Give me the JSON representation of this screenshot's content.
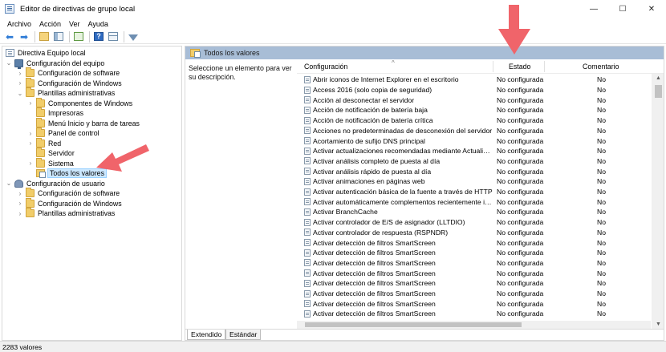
{
  "window": {
    "title": "Editor de directivas de grupo local",
    "controls": [
      "—",
      "☐",
      "✕"
    ]
  },
  "menu": [
    "Archivo",
    "Acción",
    "Ver",
    "Ayuda"
  ],
  "toolbar_icons": [
    "back-arrow-icon",
    "forward-arrow-icon",
    "up-folder-icon",
    "show-pane-icon",
    "export-list-icon",
    "help-icon",
    "properties-icon",
    "filter-icon"
  ],
  "tree": {
    "root": "Directiva Equipo local",
    "items": [
      {
        "label": "Configuración del equipo",
        "icon": "computer-icon",
        "twisty": "⌄",
        "level": 1
      },
      {
        "label": "Configuración de software",
        "icon": "folder-icon",
        "twisty": "›",
        "level": 2
      },
      {
        "label": "Configuración de Windows",
        "icon": "folder-icon",
        "twisty": "›",
        "level": 2
      },
      {
        "label": "Plantillas administrativas",
        "icon": "folder-icon",
        "twisty": "⌄",
        "level": 2
      },
      {
        "label": "Componentes de Windows",
        "icon": "folder-icon",
        "twisty": "›",
        "level": 3
      },
      {
        "label": "Impresoras",
        "icon": "folder-icon",
        "twisty": "",
        "level": 3
      },
      {
        "label": "Menú Inicio y barra de tareas",
        "icon": "folder-icon",
        "twisty": "",
        "level": 3
      },
      {
        "label": "Panel de control",
        "icon": "folder-icon",
        "twisty": "›",
        "level": 3
      },
      {
        "label": "Red",
        "icon": "folder-icon",
        "twisty": "›",
        "level": 3
      },
      {
        "label": "Servidor",
        "icon": "folder-icon",
        "twisty": "",
        "level": 3
      },
      {
        "label": "Sistema",
        "icon": "folder-icon",
        "twisty": "›",
        "level": 3
      },
      {
        "label": "Todos los valores",
        "icon": "all-settings-icon",
        "twisty": "",
        "level": 3,
        "selected": true
      },
      {
        "label": "Configuración de usuario",
        "icon": "user-icon",
        "twisty": "⌄",
        "level": 1
      },
      {
        "label": "Configuración de software",
        "icon": "folder-icon",
        "twisty": "›",
        "level": 2
      },
      {
        "label": "Configuración de Windows",
        "icon": "folder-icon",
        "twisty": "›",
        "level": 2
      },
      {
        "label": "Plantillas administrativas",
        "icon": "folder-icon",
        "twisty": "›",
        "level": 2
      }
    ]
  },
  "right_pane": {
    "title": "Todos los valores",
    "description": "Seleccione un elemento para ver su descripción.",
    "columns": {
      "name": "Configuración",
      "state": "Estado",
      "comment": "Comentario"
    },
    "sort_caret": "^",
    "rows": [
      {
        "name": "Abrir iconos de Internet Explorer en el escritorio",
        "state": "No configurada",
        "comment": "No"
      },
      {
        "name": "Access 2016 (solo copia de seguridad)",
        "state": "No configurada",
        "comment": "No"
      },
      {
        "name": "Acción al desconectar el servidor",
        "state": "No configurada",
        "comment": "No"
      },
      {
        "name": "Acción de notificación de batería baja",
        "state": "No configurada",
        "comment": "No"
      },
      {
        "name": "Acción de notificación de batería crítica",
        "state": "No configurada",
        "comment": "No"
      },
      {
        "name": "Acciones no predeterminadas de desconexión del servidor",
        "state": "No configurada",
        "comment": "No"
      },
      {
        "name": "Acortamiento de sufijo DNS principal",
        "state": "No configurada",
        "comment": "No"
      },
      {
        "name": "Activar actualizaciones recomendadas mediante Actualizaci...",
        "state": "No configurada",
        "comment": "No"
      },
      {
        "name": "Activar análisis completo de puesta al día",
        "state": "No configurada",
        "comment": "No"
      },
      {
        "name": "Activar análisis rápido de puesta al día",
        "state": "No configurada",
        "comment": "No"
      },
      {
        "name": "Activar animaciones en páginas web",
        "state": "No configurada",
        "comment": "No"
      },
      {
        "name": "Activar autenticación básica de la fuente a través de HTTP",
        "state": "No configurada",
        "comment": "No"
      },
      {
        "name": "Activar automáticamente complementos recientemente ins...",
        "state": "No configurada",
        "comment": "No"
      },
      {
        "name": "Activar BranchCache",
        "state": "No configurada",
        "comment": "No"
      },
      {
        "name": "Activar controlador de E/S de asignador (LLTDIO)",
        "state": "No configurada",
        "comment": "No"
      },
      {
        "name": "Activar controlador de respuesta (RSPNDR)",
        "state": "No configurada",
        "comment": "No"
      },
      {
        "name": "Activar detección de filtros SmartScreen",
        "state": "No configurada",
        "comment": "No"
      },
      {
        "name": "Activar detección de filtros SmartScreen",
        "state": "No configurada",
        "comment": "No"
      },
      {
        "name": "Activar detección de filtros SmartScreen",
        "state": "No configurada",
        "comment": "No"
      },
      {
        "name": "Activar detección de filtros SmartScreen",
        "state": "No configurada",
        "comment": "No"
      },
      {
        "name": "Activar detección de filtros SmartScreen",
        "state": "No configurada",
        "comment": "No"
      },
      {
        "name": "Activar detección de filtros SmartScreen",
        "state": "No configurada",
        "comment": "No"
      },
      {
        "name": "Activar detección de filtros SmartScreen",
        "state": "No configurada",
        "comment": "No"
      },
      {
        "name": "Activar detección de filtros SmartScreen",
        "state": "No configurada",
        "comment": "No"
      }
    ],
    "tabs": [
      "Extendido",
      "Estándar"
    ]
  },
  "status": "2283 valores",
  "colors": {
    "header_blue": "#a8bdd6",
    "annotation_arrow": "#f0646a",
    "selection": "#cce8ff"
  }
}
